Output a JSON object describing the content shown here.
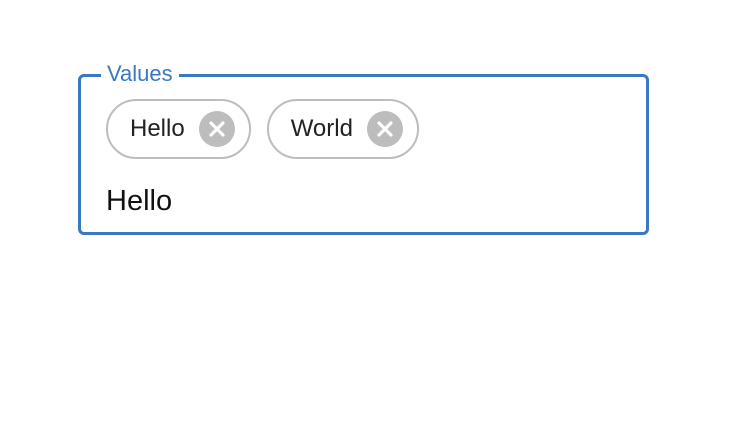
{
  "field": {
    "legend": "Values",
    "accent_color": "#3a78c2"
  },
  "chips": [
    {
      "label": "Hello",
      "remove_icon": "close-circle-icon"
    },
    {
      "label": "World",
      "remove_icon": "close-circle-icon"
    }
  ],
  "input": {
    "value": "Hello"
  }
}
